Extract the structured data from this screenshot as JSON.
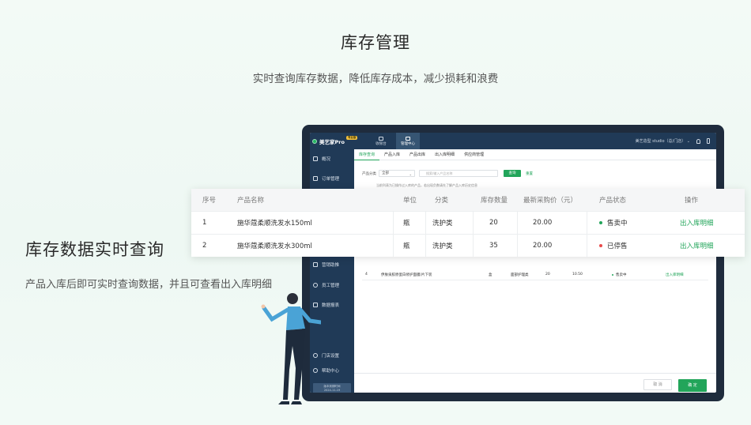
{
  "hero": {
    "title": "库存管理",
    "subtitle": "实时查询库存数据，降低库存成本，减少损耗和浪费"
  },
  "feature": {
    "title": "库存数据实时查询",
    "desc": "产品入库后即可实时查询数据，并且可查看出入库明细"
  },
  "app": {
    "logo": "美艺家Pro",
    "logo_badge": "专业版",
    "topnav": [
      "收银台",
      "管理中心"
    ],
    "store": "美艺造型 studio（总/门店） ⌄",
    "sidebar": [
      "概况",
      "订单管理",
      "营销助推",
      "员工管理",
      "数据报表",
      "门店设置",
      "帮助中心"
    ],
    "expire": [
      "版本到期时间",
      "2024-11-19"
    ],
    "tabs": [
      "库存查询",
      "产品入库",
      "产品出库",
      "出入库明细",
      "供应商管理"
    ],
    "filter": {
      "label": "产品分类",
      "select": "全部",
      "search_placeholder": "搜索/输入产品名称",
      "query": "查询",
      "reset": "重置"
    },
    "hint": "当前列表为已操作过入库的产品，若出现负数请先了解产品入库历史信息",
    "row4": {
      "no": "4",
      "name": "伊肤泉胶原蛋白修护面膜/片下装",
      "unit": "盒",
      "category": "面部护理类",
      "qty": "20",
      "price": "10.50",
      "status": "售卖中",
      "action": "出入库明细"
    },
    "footer": {
      "cancel": "取 消",
      "ok": "确 定"
    }
  },
  "table": {
    "headers": [
      "序号",
      "产品名称",
      "单位",
      "分类",
      "库存数量",
      "最新采购价（元）",
      "产品状态",
      "操作"
    ],
    "rows": [
      {
        "no": "1",
        "name": "施华蔻柔顺洗发水150ml",
        "unit": "瓶",
        "category": "洗护类",
        "qty": "20",
        "price": "20.00",
        "status": "售卖中",
        "action": "出入库明细"
      },
      {
        "no": "2",
        "name": "施华蔻柔顺洗发水300ml",
        "unit": "瓶",
        "category": "洗护类",
        "qty": "35",
        "price": "20.00",
        "status": "已停售",
        "action": "出入库明细"
      }
    ]
  },
  "colors": {
    "accent": "#22a55a",
    "sidebar": "#203a57",
    "status_on": "#22a55a",
    "status_off": "#e84a4a"
  }
}
